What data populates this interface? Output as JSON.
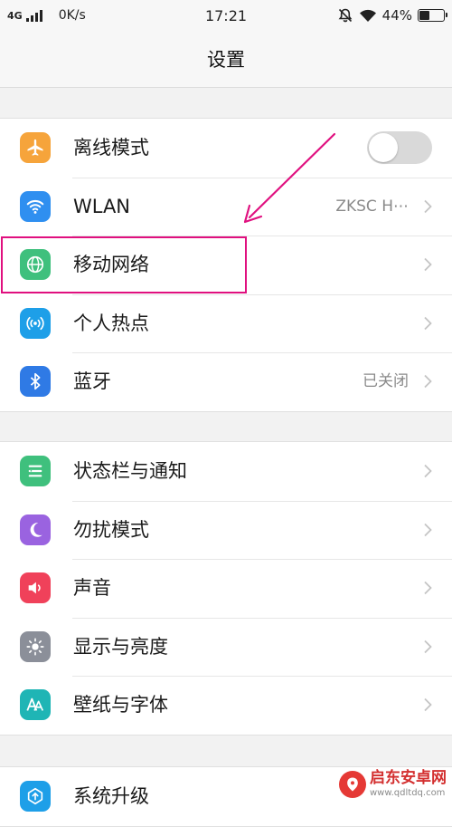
{
  "status_bar": {
    "network": "4G",
    "speed": "0K/s",
    "time": "17:21",
    "battery": "44%",
    "battery_level": 0.44
  },
  "header": {
    "title": "设置"
  },
  "groups": [
    {
      "items": [
        {
          "label": "离线模式",
          "icon": "airplane-icon",
          "icon_color": "#f6a43b",
          "control": "toggle",
          "toggle_on": false
        },
        {
          "label": "WLAN",
          "icon": "wifi-icon",
          "icon_color": "#2f8ff0",
          "value": "ZKSC H⋯"
        },
        {
          "label": "移动网络",
          "icon": "globe-icon",
          "icon_color": "#3fc07d"
        },
        {
          "label": "个人热点",
          "icon": "hotspot-icon",
          "icon_color": "#1e9fe8"
        },
        {
          "label": "蓝牙",
          "icon": "bluetooth-icon",
          "icon_color": "#2f7ae5",
          "value": "已关闭"
        }
      ]
    },
    {
      "items": [
        {
          "label": "状态栏与通知",
          "icon": "notification-icon",
          "icon_color": "#3fc07d"
        },
        {
          "label": "勿扰模式",
          "icon": "moon-icon",
          "icon_color": "#9a63e0"
        },
        {
          "label": "声音",
          "icon": "speaker-icon",
          "icon_color": "#f0415a"
        },
        {
          "label": "显示与亮度",
          "icon": "brightness-icon",
          "icon_color": "#8b8f99"
        },
        {
          "label": "壁纸与字体",
          "icon": "font-icon",
          "icon_color": "#1fb5b5"
        }
      ]
    },
    {
      "items": [
        {
          "label": "系统升级",
          "icon": "upgrade-icon",
          "icon_color": "#1e9fe8"
        }
      ]
    }
  ],
  "annotation": {
    "color": "#e0107f"
  },
  "watermark": {
    "title": "启东安卓网",
    "url": "www.qdltdq.com"
  }
}
